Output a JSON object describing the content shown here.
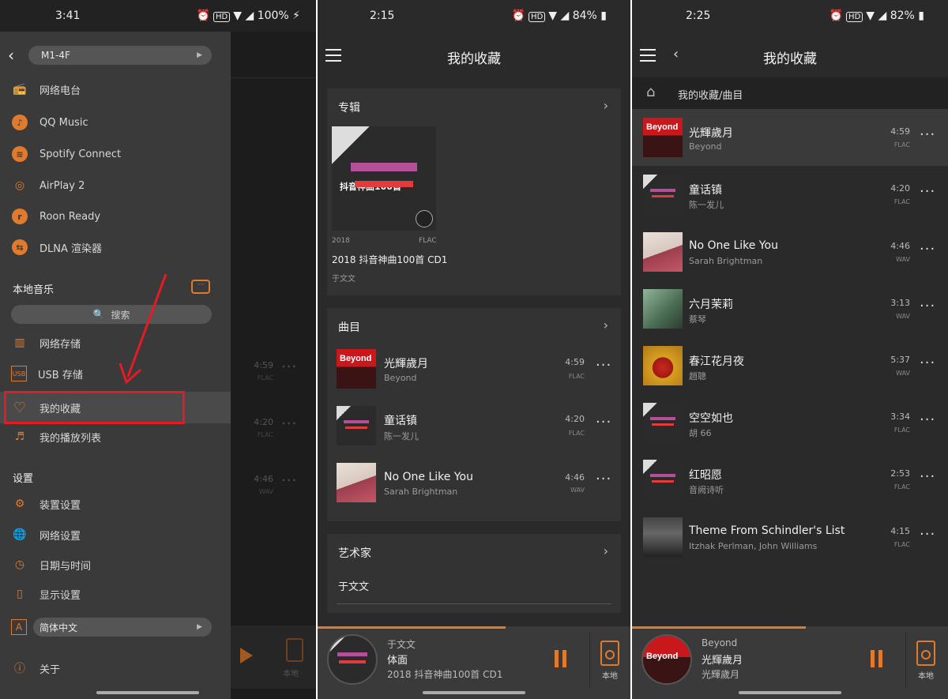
{
  "panel1": {
    "status": {
      "time": "3:41",
      "battery": "100%",
      "hd": "HD"
    },
    "device": "M1-4F",
    "sources": [
      {
        "label": "网络电台",
        "icon": "radio-icon"
      },
      {
        "label": "QQ Music",
        "icon": "qq-music-icon"
      },
      {
        "label": "Spotify Connect",
        "icon": "spotify-icon"
      },
      {
        "label": "AirPlay 2",
        "icon": "airplay-icon"
      },
      {
        "label": "Roon Ready",
        "icon": "roon-icon"
      },
      {
        "label": "DLNA 渲染器",
        "icon": "dlna-icon"
      }
    ],
    "local_title": "本地音乐",
    "search_placeholder": "搜索",
    "local_items": [
      {
        "label": "网络存储",
        "icon": "nas-icon"
      },
      {
        "label": "USB 存储",
        "icon": "usb-icon"
      },
      {
        "label": "我的收藏",
        "icon": "heart-icon"
      },
      {
        "label": "我的播放列表",
        "icon": "playlist-icon"
      }
    ],
    "settings_title": "设置",
    "settings_items": [
      {
        "label": "装置设置",
        "icon": "gear-icon"
      },
      {
        "label": "网络设置",
        "icon": "globe-icon"
      },
      {
        "label": "日期与时间",
        "icon": "clock-icon"
      },
      {
        "label": "显示设置",
        "icon": "display-icon"
      }
    ],
    "language": "简体中文",
    "about": "关于",
    "bg_times": [
      {
        "dur": "4:59",
        "fmt": "FLAC"
      },
      {
        "dur": "4:20",
        "fmt": "FLAC"
      },
      {
        "dur": "4:46",
        "fmt": "WAV"
      }
    ],
    "bg_local": "本地"
  },
  "panel2": {
    "status": {
      "time": "2:15",
      "battery": "84%",
      "hd": "HD"
    },
    "title": "我的收藏",
    "album_section": "专辑",
    "album": {
      "year": "2018",
      "format": "FLAC",
      "title": "2018 抖音神曲100首 CD1",
      "artist": "于文文",
      "cover_text": "抖音神曲100首"
    },
    "tracks_section": "曲目",
    "tracks": [
      {
        "title": "光輝歲月",
        "artist": "Beyond",
        "dur": "4:59",
        "fmt": "FLAC",
        "art": "beyond"
      },
      {
        "title": "童话镇",
        "artist": "陈一发儿",
        "dur": "4:20",
        "fmt": "FLAC",
        "art": "tk"
      },
      {
        "title": "No One Like You",
        "artist": "Sarah Brightman",
        "dur": "4:46",
        "fmt": "WAV",
        "art": "sarah"
      }
    ],
    "artists_section": "艺术家",
    "artist_item": "于文文",
    "player": {
      "artist": "于文文",
      "title": "体面",
      "album": "2018 抖音神曲100首 CD1",
      "output": "本地",
      "progress": 0.6
    }
  },
  "panel3": {
    "status": {
      "time": "2:25",
      "battery": "82%",
      "hd": "HD"
    },
    "title": "我的收藏",
    "breadcrumb": "我的收藏/曲目",
    "tracks": [
      {
        "title": "光輝歲月",
        "artist": "Beyond",
        "dur": "4:59",
        "fmt": "FLAC",
        "art": "beyond"
      },
      {
        "title": "童话镇",
        "artist": "陈一发儿",
        "dur": "4:20",
        "fmt": "FLAC",
        "art": "tk"
      },
      {
        "title": "No One Like You",
        "artist": "Sarah Brightman",
        "dur": "4:46",
        "fmt": "WAV",
        "art": "sarah"
      },
      {
        "title": "六月茉莉",
        "artist": "蔡琴",
        "dur": "3:13",
        "fmt": "WAV",
        "art": "cai"
      },
      {
        "title": "春江花月夜",
        "artist": "趙聰",
        "dur": "5:37",
        "fmt": "WAV",
        "art": "zhao"
      },
      {
        "title": "空空如也",
        "artist": "胡 66",
        "dur": "3:34",
        "fmt": "FLAC",
        "art": "tk"
      },
      {
        "title": "红昭愿",
        "artist": "音阙诗听",
        "dur": "2:53",
        "fmt": "FLAC",
        "art": "tk"
      },
      {
        "title": "Theme From Schindler's List",
        "artist": "Itzhak Perlman, John Williams",
        "dur": "4:15",
        "fmt": "FLAC",
        "art": "sch"
      }
    ],
    "player": {
      "artist": "Beyond",
      "title": "光輝歲月",
      "album": "光輝歲月",
      "output": "本地",
      "progress": 0.55
    }
  },
  "colors": {
    "accent": "#e07a2c",
    "highlight": "#e51b24"
  }
}
